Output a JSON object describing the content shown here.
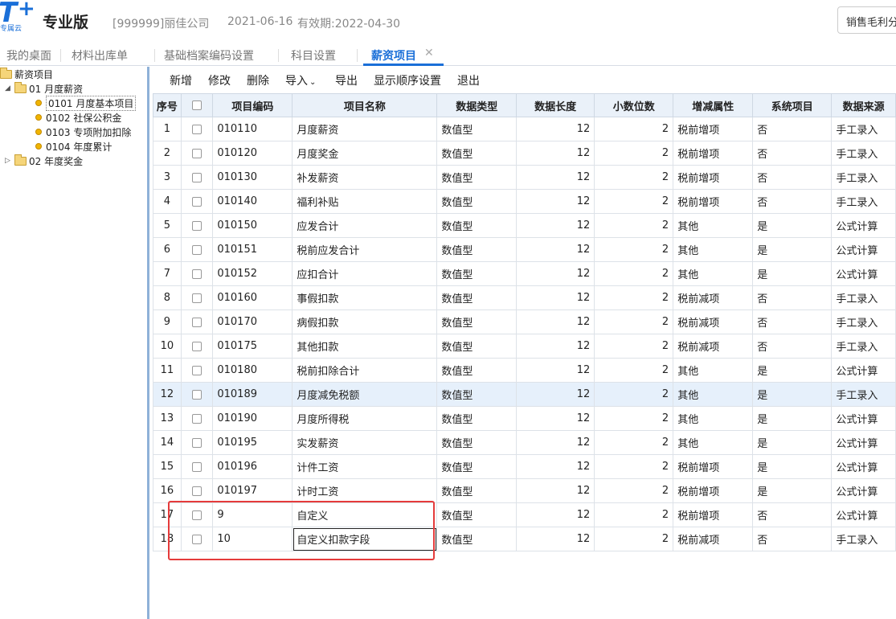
{
  "header": {
    "logo_text": "T",
    "logo_sub": "专属云",
    "edition": "专业版",
    "company": "[999999]丽佳公司",
    "date": "2021-06-16",
    "valid": "有效期:2022-04-30",
    "right_box": "销售毛利分"
  },
  "tabs": [
    {
      "label": "我的桌面"
    },
    {
      "label": "材料出库单"
    },
    {
      "label": "基础档案编码设置"
    },
    {
      "label": "科目设置"
    },
    {
      "label": "薪资项目",
      "active": true
    }
  ],
  "tree": {
    "root": "薪资项目",
    "group1": "01 月度薪资",
    "children": [
      "0101 月度基本项目",
      "0102 社保公积金",
      "0103 专项附加扣除",
      "0104 年度累计"
    ],
    "group2": "02 年度奖金"
  },
  "toolbar": {
    "add": "新增",
    "edit": "修改",
    "delete": "删除",
    "import": "导入",
    "export": "导出",
    "order": "显示顺序设置",
    "exit": "退出"
  },
  "columns": [
    "序号",
    "",
    "项目编码",
    "项目名称",
    "数据类型",
    "数据长度",
    "小数位数",
    "增减属性",
    "系统项目",
    "数据来源"
  ],
  "rows": [
    {
      "no": "1",
      "code": "010110",
      "name": "月度薪资",
      "type": "数值型",
      "len": "12",
      "dec": "2",
      "attr": "税前增项",
      "sys": "否",
      "src": "手工录入"
    },
    {
      "no": "2",
      "code": "010120",
      "name": "月度奖金",
      "type": "数值型",
      "len": "12",
      "dec": "2",
      "attr": "税前增项",
      "sys": "否",
      "src": "手工录入"
    },
    {
      "no": "3",
      "code": "010130",
      "name": "补发薪资",
      "type": "数值型",
      "len": "12",
      "dec": "2",
      "attr": "税前增项",
      "sys": "否",
      "src": "手工录入"
    },
    {
      "no": "4",
      "code": "010140",
      "name": "福利补贴",
      "type": "数值型",
      "len": "12",
      "dec": "2",
      "attr": "税前增项",
      "sys": "否",
      "src": "手工录入"
    },
    {
      "no": "5",
      "code": "010150",
      "name": "应发合计",
      "type": "数值型",
      "len": "12",
      "dec": "2",
      "attr": "其他",
      "sys": "是",
      "src": "公式计算"
    },
    {
      "no": "6",
      "code": "010151",
      "name": "税前应发合计",
      "type": "数值型",
      "len": "12",
      "dec": "2",
      "attr": "其他",
      "sys": "是",
      "src": "公式计算"
    },
    {
      "no": "7",
      "code": "010152",
      "name": "应扣合计",
      "type": "数值型",
      "len": "12",
      "dec": "2",
      "attr": "其他",
      "sys": "是",
      "src": "公式计算"
    },
    {
      "no": "8",
      "code": "010160",
      "name": "事假扣款",
      "type": "数值型",
      "len": "12",
      "dec": "2",
      "attr": "税前减项",
      "sys": "否",
      "src": "手工录入"
    },
    {
      "no": "9",
      "code": "010170",
      "name": "病假扣款",
      "type": "数值型",
      "len": "12",
      "dec": "2",
      "attr": "税前减项",
      "sys": "否",
      "src": "手工录入"
    },
    {
      "no": "10",
      "code": "010175",
      "name": "其他扣款",
      "type": "数值型",
      "len": "12",
      "dec": "2",
      "attr": "税前减项",
      "sys": "否",
      "src": "手工录入"
    },
    {
      "no": "11",
      "code": "010180",
      "name": "税前扣除合计",
      "type": "数值型",
      "len": "12",
      "dec": "2",
      "attr": "其他",
      "sys": "是",
      "src": "公式计算"
    },
    {
      "no": "12",
      "code": "010189",
      "name": "月度减免税额",
      "type": "数值型",
      "len": "12",
      "dec": "2",
      "attr": "其他",
      "sys": "是",
      "src": "手工录入",
      "highlight": true
    },
    {
      "no": "13",
      "code": "010190",
      "name": "月度所得税",
      "type": "数值型",
      "len": "12",
      "dec": "2",
      "attr": "其他",
      "sys": "是",
      "src": "公式计算"
    },
    {
      "no": "14",
      "code": "010195",
      "name": "实发薪资",
      "type": "数值型",
      "len": "12",
      "dec": "2",
      "attr": "其他",
      "sys": "是",
      "src": "公式计算"
    },
    {
      "no": "15",
      "code": "010196",
      "name": "计件工资",
      "type": "数值型",
      "len": "12",
      "dec": "2",
      "attr": "税前增项",
      "sys": "是",
      "src": "公式计算"
    },
    {
      "no": "16",
      "code": "010197",
      "name": "计时工资",
      "type": "数值型",
      "len": "12",
      "dec": "2",
      "attr": "税前增项",
      "sys": "是",
      "src": "公式计算"
    },
    {
      "no": "17",
      "code": "9",
      "name": "自定义",
      "type": "数值型",
      "len": "12",
      "dec": "2",
      "attr": "税前增项",
      "sys": "否",
      "src": "公式计算"
    },
    {
      "no": "18",
      "code": "10",
      "name": "自定义扣款字段",
      "type": "数值型",
      "len": "12",
      "dec": "2",
      "attr": "税前减项",
      "sys": "否",
      "src": "手工录入",
      "editing": true
    }
  ],
  "colors": {
    "accent": "#1a6fd8",
    "annotation": "#e53b3b",
    "header_bg": "#eaf1f9",
    "highlight_row": "#e6f0fb"
  }
}
